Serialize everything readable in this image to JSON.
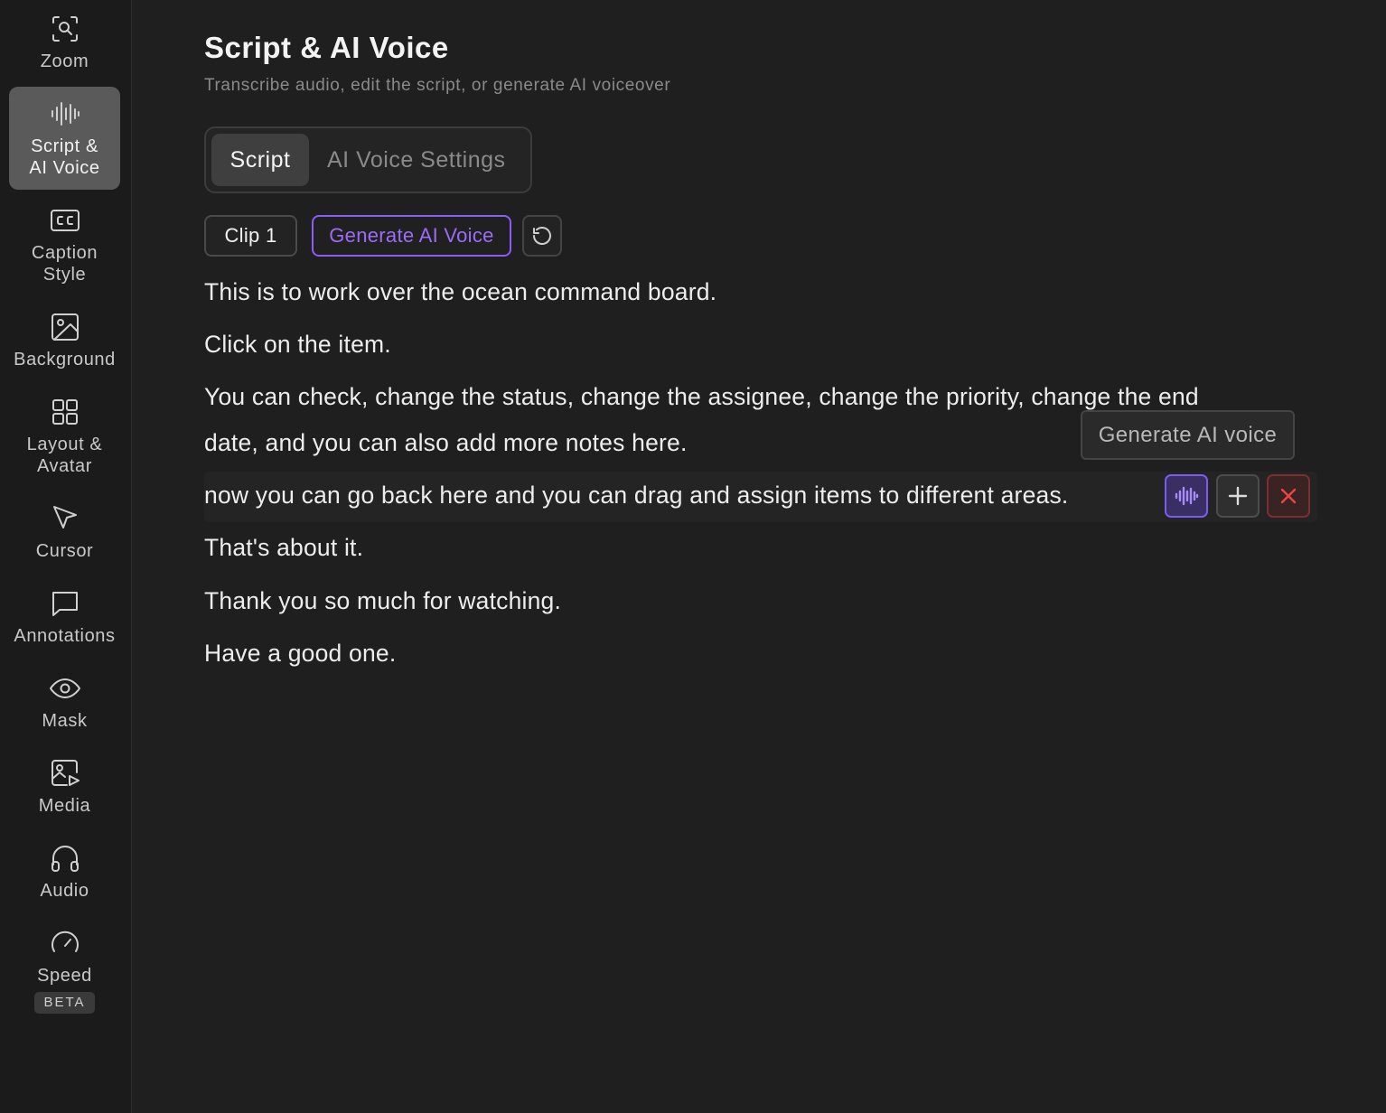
{
  "sidebar": {
    "items": [
      {
        "label": "Zoom",
        "icon": "zoom-icon"
      },
      {
        "label": "Script &\nAI Voice",
        "icon": "waveform-icon",
        "active": true
      },
      {
        "label": "Caption\nStyle",
        "icon": "cc-icon"
      },
      {
        "label": "Background",
        "icon": "image-icon"
      },
      {
        "label": "Layout &\nAvatar",
        "icon": "grid-icon"
      },
      {
        "label": "Cursor",
        "icon": "cursor-icon"
      },
      {
        "label": "Annotations",
        "icon": "speech-bubble-icon"
      },
      {
        "label": "Mask",
        "icon": "eye-icon"
      },
      {
        "label": "Media",
        "icon": "media-icon"
      },
      {
        "label": "Audio",
        "icon": "headphones-icon"
      },
      {
        "label": "Speed",
        "icon": "gauge-icon",
        "badge": "BETA"
      }
    ]
  },
  "header": {
    "title": "Script & AI Voice",
    "subtitle": "Transcribe audio, edit the script, or generate AI voiceover"
  },
  "tabs": [
    {
      "label": "Script",
      "active": true
    },
    {
      "label": "AI Voice Settings",
      "active": false
    }
  ],
  "toolbar": {
    "clip_label": "Clip 1",
    "generate_label": "Generate AI Voice",
    "refresh_icon": "refresh-icon"
  },
  "script": {
    "lines": [
      "This is to work over the ocean command board.",
      "Click on the item.",
      "You can check, change the status, change the assignee, change the priority, change the end",
      "date, and you can also add more notes here.",
      "now you can go back here and you can drag and assign items to different areas.",
      "That's about it.",
      "Thank you so much for watching.",
      "Have a good one."
    ]
  },
  "tooltip": "Generate AI voice",
  "line_actions": [
    "waveform-icon",
    "plus-icon",
    "close-icon"
  ],
  "colors": {
    "accent": "#8b5cf6",
    "danger": "#ef4444",
    "background": "#1f1f1f",
    "sidebar": "#1b1b1b"
  }
}
